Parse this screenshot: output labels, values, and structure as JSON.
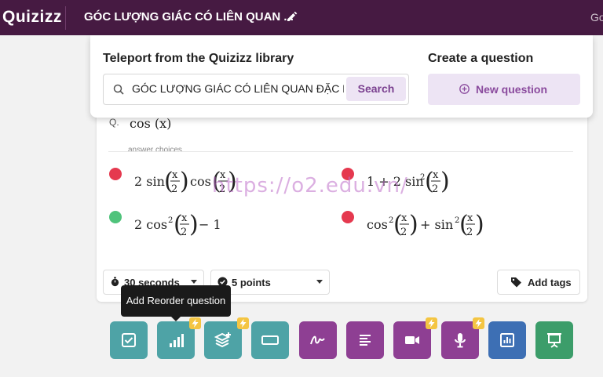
{
  "header": {
    "logo": "Quizizz",
    "quiz_title": "GÓC LƯỢNG GIÁC CÓ LIÊN QUAN ...",
    "right_text": "Go"
  },
  "library": {
    "heading": "Teleport from the Quizizz library",
    "search_value": "GÓC LƯỢNG GIÁC CÓ LIÊN QUAN ĐẶC BIỆT",
    "search_button": "Search"
  },
  "create": {
    "heading": "Create a question",
    "new_question": "New question"
  },
  "question": {
    "q_label": "Q.",
    "text": "cos (x)",
    "choices_label": "answer choices",
    "choices": [
      {
        "text": "2 sin(x/2) cos(x/2)",
        "correct": false
      },
      {
        "text": "1 + 2 sin²(x/2)",
        "correct": false
      },
      {
        "text": "2 cos²(x/2) − 1",
        "correct": true
      },
      {
        "text": "cos²(x/2) + sin²(x/2)",
        "correct": false
      }
    ]
  },
  "settings": {
    "time": "30 seconds",
    "points": "5 points",
    "add_tags": "Add tags"
  },
  "tooltip": "Add Reorder question",
  "watermark": "https://o2.edu.vn/",
  "colors": {
    "header_bg": "#461a42",
    "accent_purple": "#8a4a9d",
    "wrong": "#e5394f",
    "correct": "#4fc37b",
    "teal": "#4ea3a6",
    "purple_tool": "#8e3f93",
    "blue_tool": "#3d6fb4",
    "green_tool": "#3c9d6a"
  },
  "toolbar": [
    {
      "name": "multiple-choice",
      "icon": "checkbox-icon",
      "bolt": false
    },
    {
      "name": "reorder",
      "icon": "bar-chart-icon",
      "bolt": true
    },
    {
      "name": "match",
      "icon": "layers-plus-icon",
      "bolt": true
    },
    {
      "name": "fill-in-blank",
      "icon": "rectangle-icon",
      "bolt": false
    },
    {
      "name": "draw",
      "icon": "signature-icon",
      "bolt": false
    },
    {
      "name": "open-ended",
      "icon": "text-lines-icon",
      "bolt": false
    },
    {
      "name": "video-response",
      "icon": "video-camera-icon",
      "bolt": true
    },
    {
      "name": "audio-response",
      "icon": "microphone-icon",
      "bolt": true
    },
    {
      "name": "poll",
      "icon": "poll-chart-icon",
      "bolt": false
    },
    {
      "name": "slide",
      "icon": "presentation-icon",
      "bolt": false
    }
  ]
}
